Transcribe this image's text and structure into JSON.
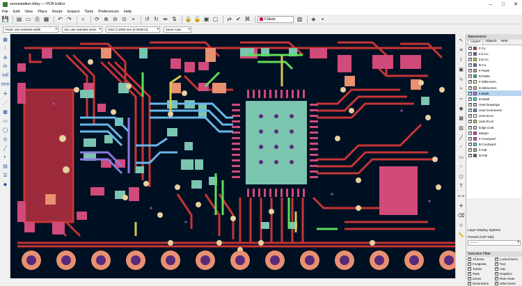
{
  "window": {
    "title": "scenewalker-bitsy — PCB Editor"
  },
  "menu": [
    "File",
    "Edit",
    "View",
    "Place",
    "Route",
    "Inspect",
    "Tools",
    "Preferences",
    "Help"
  ],
  "toolbar": {
    "active_layer": "F.Mask",
    "track_width": "Track: use netclass width",
    "via_size": "Via: use netclass sizes",
    "grid": "Grid: 0.1000 mm (0.0039 in)",
    "zoom": "Zoom Auto"
  },
  "appearance": {
    "title": "Appearance",
    "tabs": [
      "Layers",
      "Objects",
      "Nets"
    ],
    "layers": [
      {
        "name": "F.Cu",
        "color": "#c83434"
      },
      {
        "name": "In1.Cu",
        "color": "#7f4fc8"
      },
      {
        "name": "In2.Cu",
        "color": "#c8c834"
      },
      {
        "name": "B.Cu",
        "color": "#4d7fc4"
      },
      {
        "name": "F.Paste",
        "color": "#b4a0a0"
      },
      {
        "name": "B.Paste",
        "color": "#00c2c2"
      },
      {
        "name": "F.Silkscreen",
        "color": "#f2eda1"
      },
      {
        "name": "B.Silkscreen",
        "color": "#e8b2a7"
      },
      {
        "name": "F.Mask",
        "color": "#d864ff"
      },
      {
        "name": "B.Mask",
        "color": "#02ffee"
      },
      {
        "name": "User.Drawings",
        "color": "#c2c2c2"
      },
      {
        "name": "User.Comments",
        "color": "#5994dc"
      },
      {
        "name": "User.Eco1",
        "color": "#b4db d2"
      },
      {
        "name": "User.Eco2",
        "color": "#d8c852"
      },
      {
        "name": "Edge.Cuts",
        "color": "#d0d2cd"
      },
      {
        "name": "Margin",
        "color": "#ff26e2"
      },
      {
        "name": "F.Courtyard",
        "color": "#ff26e2"
      },
      {
        "name": "B.Courtyard",
        "color": "#26e9ff"
      },
      {
        "name": "F.Fab",
        "color": "#afafaf"
      },
      {
        "name": "B.Fab",
        "color": "#585d84"
      }
    ],
    "selected_layer": "F.Mask",
    "layer_display_options": "Layer Display Options",
    "presets_label": "Presets (Ctrl+Tab):",
    "presets_value": "-------",
    "selection_filter_title": "Selection Filter",
    "selection_filter": [
      "All items",
      "Locked items",
      "Footprints",
      "Text",
      "Tracks",
      "Vias",
      "Pads",
      "Graphics",
      "Zones",
      "Rule Areas",
      "Dimensions",
      "Other items"
    ]
  },
  "colors": {
    "board_bg": "#001023",
    "copper": "#c83434",
    "pad_teal": "#7ac4b0",
    "pad_pink": "#d04a7a",
    "pad_salmon": "#e89070",
    "trace_blue": "#6ab8e8",
    "trace_green": "#5ee058"
  }
}
